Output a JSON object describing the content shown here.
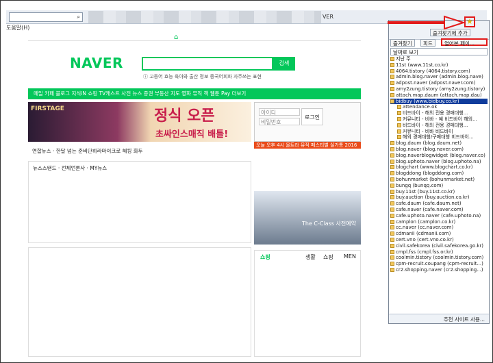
{
  "browser": {
    "tab_title": "VER",
    "menu_help": "도움말(H)"
  },
  "naver": {
    "logo": "NAVER",
    "search_btn": "검색",
    "links": "ⓘ 고등어 효능   육아와 출산 정보   중국어회화 자주쓰는 표현",
    "nav": "메일  카페  블로그  지식iN  쇼핑  TV캐스트  사전  뉴스  증권  부동산  지도  영화  뮤직  책  웹툰   Pay  더보기",
    "banner_title": "정식 오픈",
    "banner_sub": "초싸인스매직 배틀!",
    "banner_logo": "FIRSTAGE",
    "login_id": "아이디",
    "login_pw": "비밀번호",
    "login_btn": "로그인",
    "news_flash": "연합뉴스 · 한달 넘는 준비단하라마이크로 해킹 화두",
    "newsstand": "뉴스스탠드 · 전체언론사 · MY뉴스",
    "shopping": "쇼핑",
    "music_banner": "오늘 오후 4시 울트라 뮤직 페스티벌 실가통 2016",
    "ad_text": "The C-Class 사전예약",
    "sub_tabs": [
      "생활",
      "쇼핑",
      "MEN"
    ]
  },
  "sidebar": {
    "btn_add": "즐겨찾기에 추가",
    "btn_fav": "즐겨찾기",
    "btn_feed": "피드",
    "btn_history": "열어본 페이...",
    "view": "날짜로 보기",
    "footer": "추천 사이트 사용..."
  },
  "history": [
    {
      "label": "지난 주",
      "sel": false,
      "ind": false
    },
    {
      "label": "11st (www.11st.co.kr)",
      "sel": false,
      "ind": false
    },
    {
      "label": "4064.tistory (4064.tistory.com)",
      "sel": false,
      "ind": false
    },
    {
      "label": "admin.blog.naver (admin.blog.nave)",
      "sel": false,
      "ind": false
    },
    {
      "label": "adpost.naver (adpost.naver.com)",
      "sel": false,
      "ind": false
    },
    {
      "label": "amy2zung.tistory (amy2zung.tistory)",
      "sel": false,
      "ind": false
    },
    {
      "label": "attach.map.daum (attach.map.dau)",
      "sel": false,
      "ind": false
    },
    {
      "label": "bidbuy (www.bidbuy.co.kr)",
      "sel": true,
      "ind": false
    },
    {
      "label": "attendance.ok",
      "sel": false,
      "ind": true
    },
    {
      "label": "비드바이 - 해외 전용 경매대행...",
      "sel": false,
      "ind": true
    },
    {
      "label": "커뮤니티 - 비바 - 예 비드바이 해외...",
      "sel": false,
      "ind": true
    },
    {
      "label": "비드바이 - 해외 전용 경매대행...",
      "sel": false,
      "ind": true
    },
    {
      "label": "커뮤니티 - 비바 비드바이",
      "sel": false,
      "ind": true
    },
    {
      "label": "해외 경매대행/구매대행 비드바이...",
      "sel": false,
      "ind": true
    },
    {
      "label": "blog.daum (blog.daum.net)",
      "sel": false,
      "ind": false
    },
    {
      "label": "blog.naver (blog.naver.com)",
      "sel": false,
      "ind": false
    },
    {
      "label": "blog.naverblogwidget (blog.naver.co)",
      "sel": false,
      "ind": false
    },
    {
      "label": "blog.uphoto.naver (blog.uphoto.na)",
      "sel": false,
      "ind": false
    },
    {
      "label": "blogchart (www.blogchart.co.kr)",
      "sel": false,
      "ind": false
    },
    {
      "label": "blogddong (blogddong.com)",
      "sel": false,
      "ind": false
    },
    {
      "label": "bohunmarket (bohunmarket.net)",
      "sel": false,
      "ind": false
    },
    {
      "label": "bungq (bunqq.com)",
      "sel": false,
      "ind": false
    },
    {
      "label": "buy.11st (buy.11st.co.kr)",
      "sel": false,
      "ind": false
    },
    {
      "label": "buy.auction (buy.auction.co.kr)",
      "sel": false,
      "ind": false
    },
    {
      "label": "cafe.daum (cafe.daum.net)",
      "sel": false,
      "ind": false
    },
    {
      "label": "cafe.naver (cafe.naver.com)",
      "sel": false,
      "ind": false
    },
    {
      "label": "cafe.uphoto.naver (cafe.uphoto.na)",
      "sel": false,
      "ind": false
    },
    {
      "label": "camplon (camplon.co.kr)",
      "sel": false,
      "ind": false
    },
    {
      "label": "cc.naver (cc.naver.com)",
      "sel": false,
      "ind": false
    },
    {
      "label": "cdmanii (cdmanii.com)",
      "sel": false,
      "ind": false
    },
    {
      "label": "cert.vno (cert.vno.co.kr)",
      "sel": false,
      "ind": false
    },
    {
      "label": "civil.safekorea (civil.safekorea.go.kr)",
      "sel": false,
      "ind": false
    },
    {
      "label": "cmpl.fss (cmpl.fss.or.kr)",
      "sel": false,
      "ind": false
    },
    {
      "label": "coolmin.tistory (coolmin.tistory.com)",
      "sel": false,
      "ind": false
    },
    {
      "label": "cpm-recruit.coupang (cpm-recruit...)",
      "sel": false,
      "ind": false
    },
    {
      "label": "cr2.shopping.naver (cr2.shopping...)",
      "sel": false,
      "ind": false
    }
  ]
}
